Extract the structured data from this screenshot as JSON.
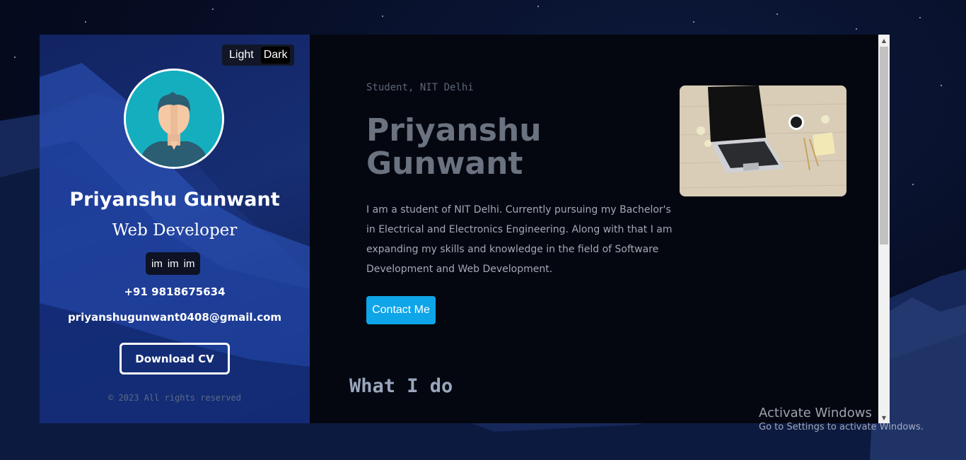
{
  "theme_toggle": {
    "light": "Light",
    "dark": "Dark",
    "active": "dark"
  },
  "profile": {
    "name": "Priyanshu Gunwant",
    "role": "Web Developer",
    "socials": [
      "im",
      "im",
      "im"
    ],
    "phone": "+91 9818675634",
    "email": "priyanshugunwant0408@gmail.com",
    "cv_button": "Download CV",
    "copyright": "© 2023 All rights reserved"
  },
  "hero": {
    "eyebrow": "Student, NIT Delhi",
    "name": "Priyanshu Gunwant",
    "bio": "I am a student of NIT Delhi. Currently pursuing my Bachelor's in Electrical and Electronics Engineering. Along with that I am expanding my skills and knowledge in the field of Software Development and Web Development.",
    "contact_button": "Contact Me"
  },
  "sections": {
    "what_i_do": "What I do"
  },
  "windows_watermark": {
    "title": "Activate Windows",
    "subtitle": "Go to Settings to activate Windows."
  },
  "colors": {
    "accent": "#0ea5e9",
    "avatar_bg": "#14aebf",
    "main_bg": "#04070f"
  },
  "icons": {
    "scroll_up": "scroll-up-arrow-icon",
    "scroll_down": "scroll-down-arrow-icon",
    "avatar": "person-avatar-icon"
  }
}
